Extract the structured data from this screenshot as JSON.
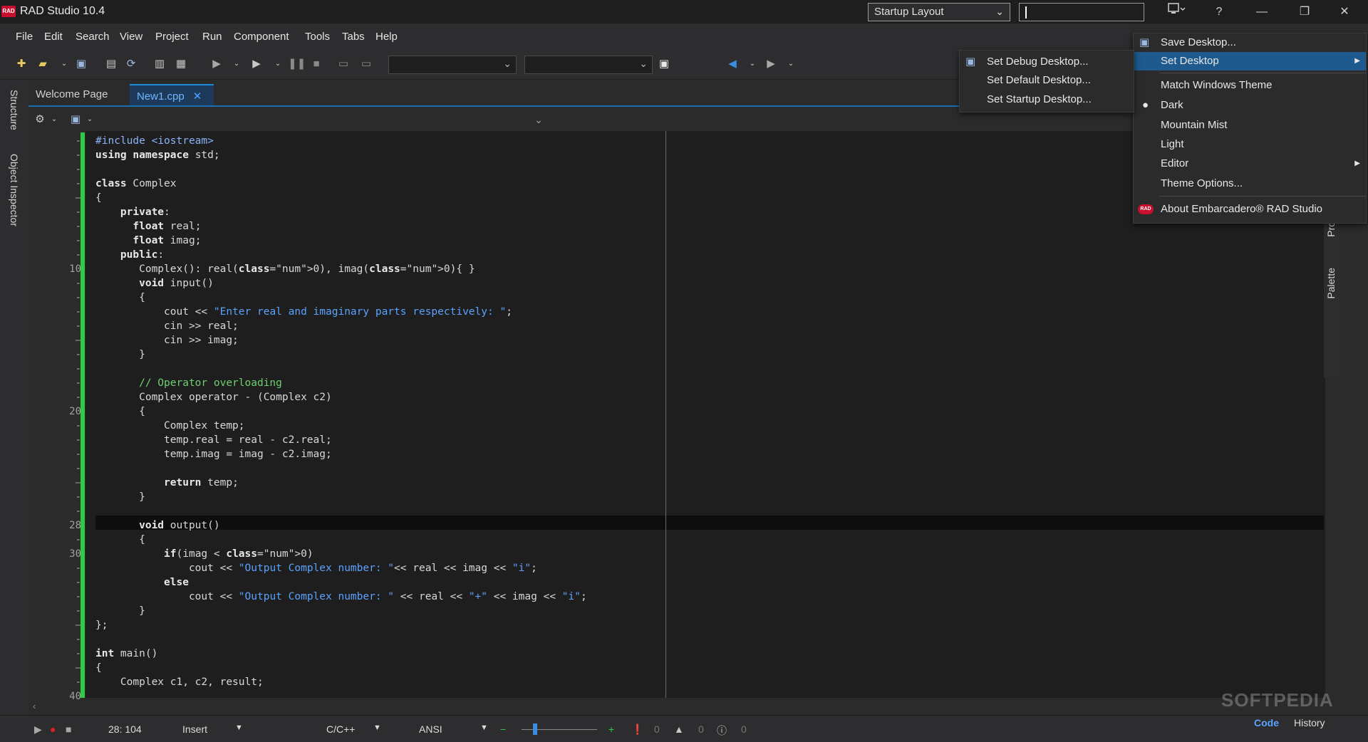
{
  "window": {
    "title": "RAD Studio 10.4",
    "logo_text": "RAD",
    "layout_select": "Startup Layout",
    "controls": [
      "?",
      "—",
      "❐",
      "✕"
    ]
  },
  "menubar": [
    "File",
    "Edit",
    "Search",
    "View",
    "Project",
    "Run",
    "Component",
    "Tools",
    "Tabs",
    "Help"
  ],
  "left_panel": {
    "structure": "Structure",
    "object_inspector": "Object Inspector"
  },
  "right_panel": {
    "projects": "Proje",
    "palette": "Palette"
  },
  "tabs": [
    {
      "label": "Welcome Page",
      "active": false
    },
    {
      "label": "New1.cpp",
      "active": true
    }
  ],
  "code": {
    "lines": [
      {
        "n": "-",
        "t": "#include <iostream>",
        "cls": "pp"
      },
      {
        "n": "-",
        "t": "using namespace std;"
      },
      {
        "n": "-",
        "t": ""
      },
      {
        "n": "-",
        "t": "class Complex"
      },
      {
        "n": "–",
        "t": "{"
      },
      {
        "n": "-",
        "t": "    private:"
      },
      {
        "n": "-",
        "t": "      float real;"
      },
      {
        "n": "-",
        "t": "      float imag;"
      },
      {
        "n": "-",
        "t": "    public:"
      },
      {
        "n": "10",
        "t": "       Complex(): real(0), imag(0){ }"
      },
      {
        "n": "-",
        "t": "       void input()"
      },
      {
        "n": "-",
        "t": "       {"
      },
      {
        "n": "-",
        "t": "           cout << \"Enter real and imaginary parts respectively: \";"
      },
      {
        "n": "-",
        "t": "           cin >> real;"
      },
      {
        "n": "–",
        "t": "           cin >> imag;"
      },
      {
        "n": "-",
        "t": "       }"
      },
      {
        "n": "-",
        "t": ""
      },
      {
        "n": "-",
        "t": "       // Operator overloading"
      },
      {
        "n": "-",
        "t": "       Complex operator - (Complex c2)"
      },
      {
        "n": "20",
        "t": "       {"
      },
      {
        "n": "-",
        "t": "           Complex temp;"
      },
      {
        "n": "-",
        "t": "           temp.real = real - c2.real;"
      },
      {
        "n": "-",
        "t": "           temp.imag = imag - c2.imag;"
      },
      {
        "n": "-",
        "t": ""
      },
      {
        "n": "–",
        "t": "           return temp;"
      },
      {
        "n": "-",
        "t": "       }"
      },
      {
        "n": "-",
        "t": ""
      },
      {
        "n": "28",
        "t": "       void output()"
      },
      {
        "n": "-",
        "t": "       {"
      },
      {
        "n": "30",
        "t": "           if(imag < 0)"
      },
      {
        "n": "-",
        "t": "               cout << \"Output Complex number: \"<< real << imag << \"i\";"
      },
      {
        "n": "-",
        "t": "           else"
      },
      {
        "n": "-",
        "t": "               cout << \"Output Complex number: \" << real << \"+\" << imag << \"i\";"
      },
      {
        "n": "-",
        "t": "       }"
      },
      {
        "n": "–",
        "t": "};"
      },
      {
        "n": "-",
        "t": ""
      },
      {
        "n": "-",
        "t": "int main()"
      },
      {
        "n": "–",
        "t": "{"
      },
      {
        "n": "-",
        "t": "    Complex c1, c2, result;"
      },
      {
        "n": "40",
        "t": ""
      }
    ],
    "current_line": 28
  },
  "statusbar": {
    "position": "28: 104",
    "mode": "Insert",
    "language": "C/C++",
    "encoding": "ANSI",
    "errors": "0",
    "warnings": "0",
    "hints": "0",
    "tab_code": "Code",
    "tab_history": "History"
  },
  "main_menu": {
    "items": [
      {
        "label": "Save Desktop...",
        "icon": "save-desktop-icon"
      },
      {
        "label": "Set Desktop",
        "submenu": true,
        "selected": true
      },
      {
        "label": "Match Windows Theme"
      },
      {
        "label": "Dark",
        "checked": true
      },
      {
        "label": "Mountain Mist"
      },
      {
        "label": "Light"
      },
      {
        "label": "Editor",
        "submenu": true
      },
      {
        "label": "Theme Options..."
      },
      {
        "label": "About Embarcadero® RAD Studio",
        "icon": "rad-logo-icon"
      }
    ]
  },
  "submenu": {
    "items": [
      {
        "label": "Set Debug Desktop..."
      },
      {
        "label": "Set Default Desktop..."
      },
      {
        "label": "Set Startup Desktop..."
      }
    ]
  },
  "watermark": "SOFTPEDIA",
  "colors": {
    "accent": "#1b8ad8",
    "selection": "#1e5a8e",
    "green_bar": "#2ecc40",
    "string": "#5ba2ff",
    "comment": "#6fcf70",
    "number": "#e05050"
  }
}
